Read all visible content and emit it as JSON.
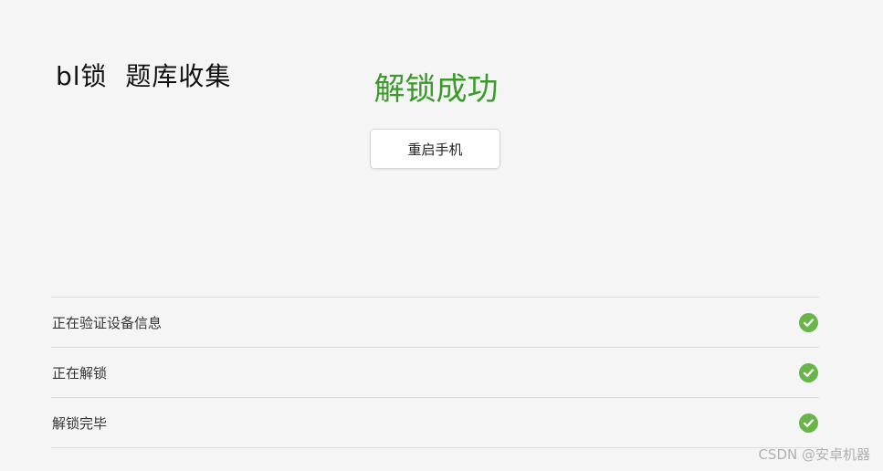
{
  "overlay_title": "bl锁  题库收集",
  "status": {
    "title": "解锁成功",
    "color": "#3a9a2a"
  },
  "reboot_button": {
    "label": "重启手机"
  },
  "steps": [
    {
      "label": "正在验证设备信息",
      "icon": "check-circle-icon",
      "done": true
    },
    {
      "label": "正在解锁",
      "icon": "check-circle-icon",
      "done": true
    },
    {
      "label": "解锁完毕",
      "icon": "check-circle-icon",
      "done": true
    }
  ],
  "check_color": "#6ab54a",
  "watermark": "CSDN @安卓机器"
}
